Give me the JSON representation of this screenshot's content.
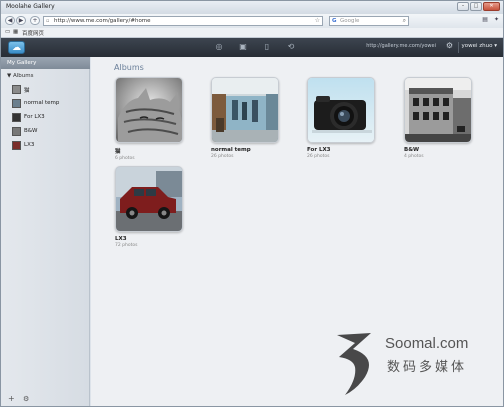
{
  "window": {
    "title": "Moolahe Gallery"
  },
  "browser": {
    "back": "◀",
    "forward": "▶",
    "new_tab": "+",
    "url": "http://www.me.com/gallery/#home",
    "search_placeholder": "Google",
    "bookmarks": [
      "百度网页"
    ]
  },
  "header": {
    "account_link": "http://gallery.me.com/yowei",
    "user_menu": "yowei zhuo ▾"
  },
  "sidebar": {
    "header": "My Gallery",
    "section": "▼ Albums",
    "items": [
      {
        "label": "猫"
      },
      {
        "label": "normal temp"
      },
      {
        "label": "For LX3"
      },
      {
        "label": "B&W"
      },
      {
        "label": "LX3"
      }
    ],
    "add": "+",
    "settings": "⚙"
  },
  "main": {
    "title": "Albums",
    "albums": [
      {
        "name": "猫",
        "count": "6 photos"
      },
      {
        "name": "normal temp",
        "count": "26 photos"
      },
      {
        "name": "For LX3",
        "count": "26 photos"
      },
      {
        "name": "B&W",
        "count": "4 photos"
      },
      {
        "name": "LX3",
        "count": "72 photos"
      }
    ]
  },
  "watermark": {
    "latin": "Soomal.com",
    "cjk": "数码多媒体"
  }
}
